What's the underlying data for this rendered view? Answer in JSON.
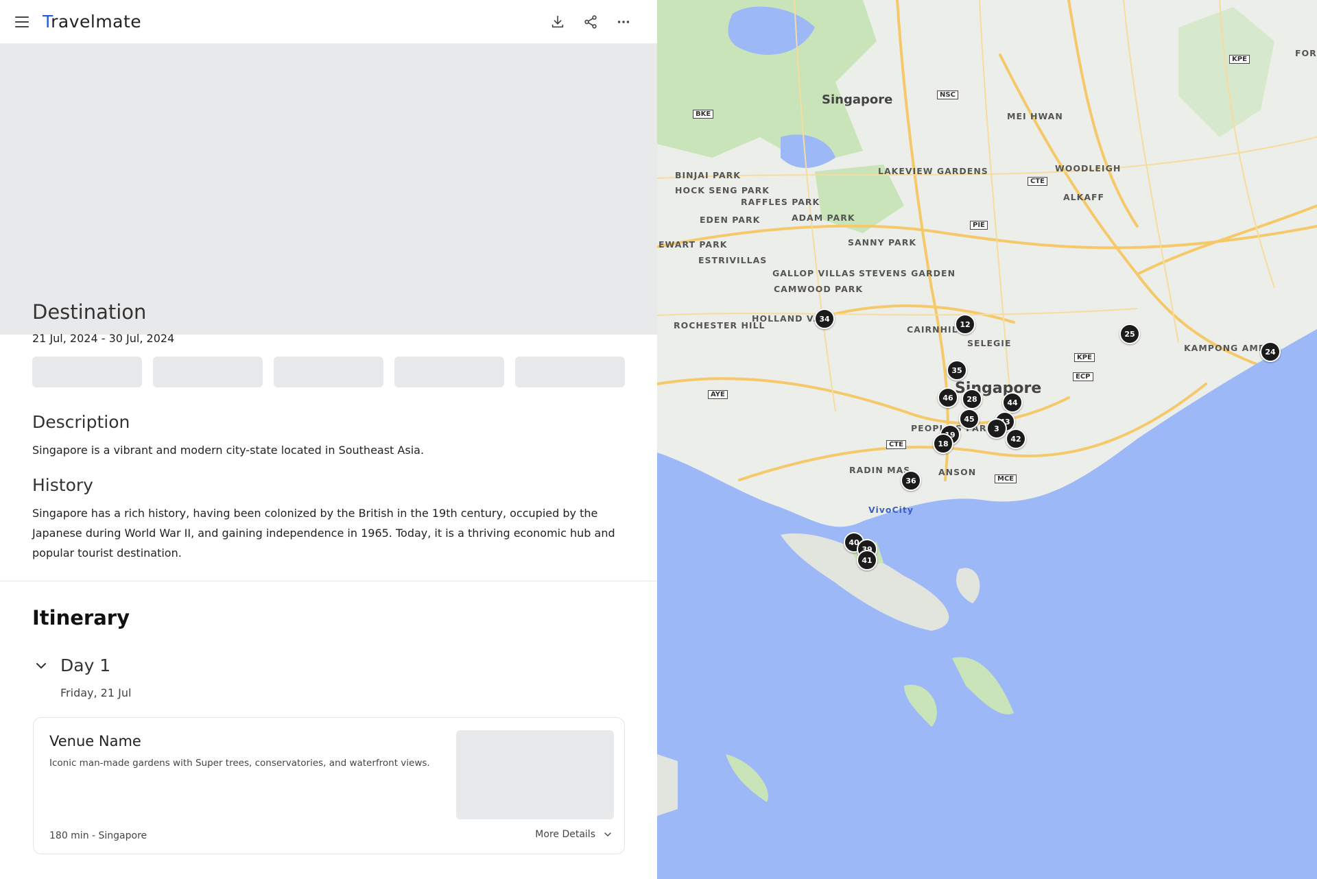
{
  "app": {
    "logo_first": "T",
    "logo_rest": "ravelmate"
  },
  "topbar": {
    "actions": [
      "download-icon",
      "share-icon",
      "more-icon"
    ]
  },
  "hero": {
    "title": "Destination",
    "dates": "21 Jul, 2024 - 30 Jul, 2024"
  },
  "description": {
    "title": "Description",
    "text": "Singapore is a vibrant and modern city-state located in Southeast Asia."
  },
  "history": {
    "title": "History",
    "text": "Singapore has a rich history, having been colonized by the British in the 19th century, occupied by the Japanese during World War II, and gaining independence in 1965. Today, it is a thriving economic hub and popular tourist destination."
  },
  "itinerary": {
    "title": "Itinerary",
    "day": {
      "label": "Day 1",
      "date": "Friday, 21 Jul"
    },
    "venue": {
      "name": "Venue Name",
      "description": "Iconic man-made gardens with Super trees, conservatories, and waterfront views.",
      "meta": "180 min - Singapore",
      "more": "More Details"
    }
  },
  "map": {
    "colors": {
      "water": "#9cb8f7",
      "land": "#eceeea",
      "green": "#c7e3b8",
      "road": "#f7d58a"
    },
    "labels": [
      "Singapore",
      "MEI HWAN",
      "WOODLEIGH",
      "ALKAFF",
      "BINJAI PARK",
      "HOCK SENG PARK",
      "RAFFLES PARK",
      "EDEN PARK",
      "ADAM PARK",
      "LAKEVIEW GARDENS",
      "SANNY PARK",
      "EWART PARK",
      "ESTRIVILLAS",
      "GALLOP VILLAS",
      "STEVENS GARDEN",
      "CAMWOOD PARK",
      "HOLLAND VALE",
      "CAIRNHILL",
      "SELEGIE",
      "ROCHESTER HILL",
      "KAMPONG AMBER",
      "PEOPLE'S PARK",
      "RADIN MAS",
      "ANSON",
      "Singapore",
      "VivoCity",
      "FORM YEANG"
    ],
    "shields": [
      "BKE",
      "NSC",
      "CTE",
      "PIE",
      "KPE",
      "ECP",
      "AYE",
      "CTE",
      "MCE",
      "KPE"
    ],
    "markers": [
      "34",
      "12",
      "25",
      "24",
      "35",
      "46",
      "28",
      "44",
      "45",
      "43",
      "3",
      "42",
      "19",
      "18",
      "36",
      "40",
      "39",
      "41"
    ]
  }
}
